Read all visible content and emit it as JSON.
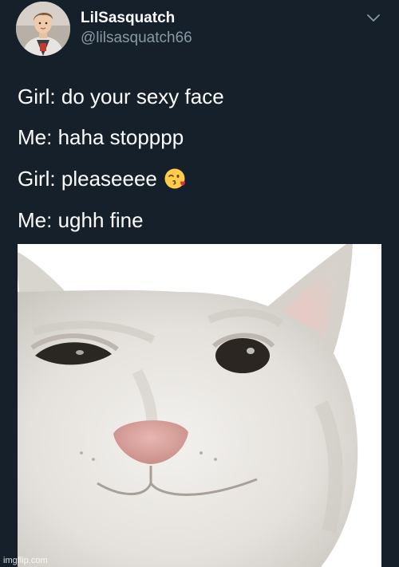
{
  "tweet": {
    "display_name": "LilSasquatch",
    "handle": "@lilsasquatch66",
    "lines": [
      "Girl: do your sexy face",
      "Me: haha stopppp",
      "Girl: pleaseeee",
      "Me: ughh fine"
    ],
    "emoji": "face-throwing-kiss"
  },
  "watermark": "imgflip.com",
  "colors": {
    "background": "#15202b",
    "text": "#ffffff",
    "secondary": "#8899a6"
  },
  "icons": {
    "menu_caret": "chevron-down-icon"
  }
}
